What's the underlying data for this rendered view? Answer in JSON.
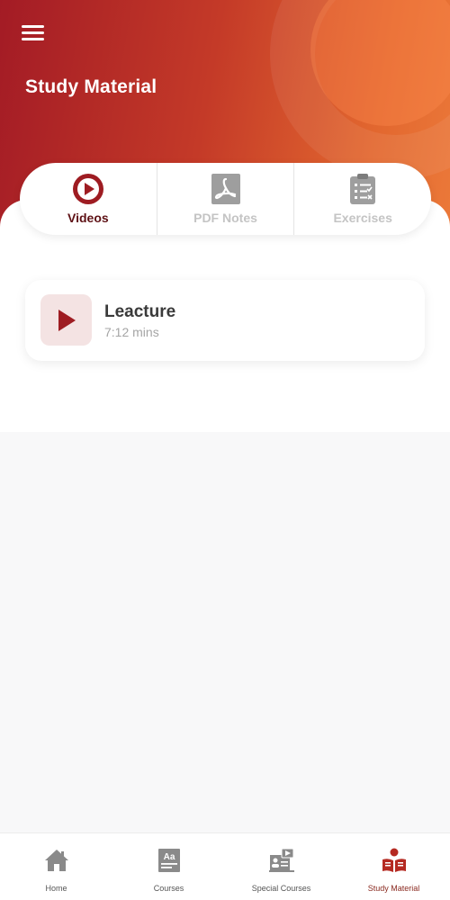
{
  "header": {
    "title": "Study Material",
    "menu_icon": "hamburger-menu-icon"
  },
  "tabs": [
    {
      "label": "Videos",
      "icon": "play-circle-icon",
      "active": true
    },
    {
      "label": "PDF Notes",
      "icon": "pdf-icon",
      "active": false
    },
    {
      "label": "Exercises",
      "icon": "clipboard-checklist-icon",
      "active": false
    }
  ],
  "lectures": [
    {
      "title": "Leacture",
      "duration": "7:12 mins",
      "icon": "play-icon"
    }
  ],
  "bottom_nav": [
    {
      "label": "Home",
      "icon": "home-icon",
      "active": false
    },
    {
      "label": "Courses",
      "icon": "courses-icon",
      "active": false
    },
    {
      "label": "Special Courses",
      "icon": "special-courses-icon",
      "active": false
    },
    {
      "label": "Study Material",
      "icon": "study-material-icon",
      "active": true
    }
  ],
  "colors": {
    "primary_dark": "#9e1c22",
    "gradient_start": "#a31b25",
    "gradient_end": "#ec7a3a",
    "active_text": "#5e1115",
    "inactive_text": "#c4c4c4"
  }
}
